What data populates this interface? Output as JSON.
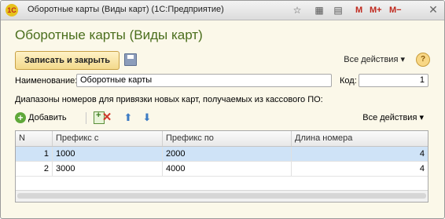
{
  "window": {
    "logo_text": "1С",
    "title": "Оборотные карты (Виды карт)  (1С:Предприятие)",
    "m_label": "M",
    "mplus_label": "M+",
    "mminus_label": "M−"
  },
  "form": {
    "title": "Оборотные карты (Виды карт)"
  },
  "toolbar": {
    "save_close_label": "Записать и закрыть",
    "all_actions_label": "Все действия ▾",
    "help_label": "?"
  },
  "fields": {
    "name_label": "Наименование:",
    "name_value": "Оборотные карты",
    "code_label": "Код:",
    "code_value": "1"
  },
  "ranges": {
    "label": "Диапазоны номеров для привязки новых карт, получаемых из кассового ПО:",
    "add_label": "Добавить",
    "all_actions_label": "Все действия ▾",
    "columns": [
      "N",
      "Префикс с",
      "Префикс по",
      "Длина номера"
    ],
    "rows": [
      {
        "n": "1",
        "prefix_from": "1000",
        "prefix_to": "2000",
        "length": "4"
      },
      {
        "n": "2",
        "prefix_from": "3000",
        "prefix_to": "4000",
        "length": "4"
      }
    ]
  },
  "colors": {
    "title_green": "#4a6e1c",
    "selected_row": "#cfe3f7",
    "primary_button": "#f3d98b"
  }
}
